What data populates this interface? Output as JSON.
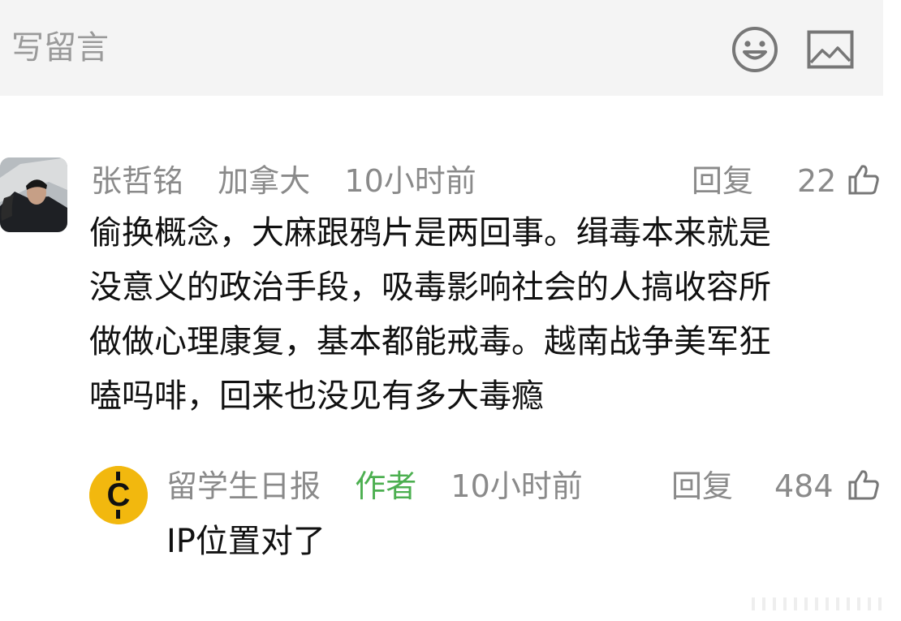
{
  "input_bar": {
    "placeholder": "写留言",
    "emoji_icon": "smiley-face-icon",
    "image_icon": "picture-icon"
  },
  "comment": {
    "username": "张哲铭",
    "location": "加拿大",
    "time": "10小时前",
    "reply_label": "回复",
    "likes": "22",
    "text_lines": [
      "偷换概念，大麻跟鸦片是两回事。缉毒本来就是",
      "没意义的政治手段，吸毒影响社会的人搞收容所",
      "做做心理康复，基本都能戒毒。越南战争美军狂",
      "嗑吗啡，回来也没见有多大毒瘾"
    ]
  },
  "reply": {
    "username": "留学生日报",
    "author_tag": "作者",
    "time": "10小时前",
    "reply_label": "回复",
    "likes": "484",
    "text": "IP位置对了",
    "avatar_letter": "C"
  },
  "colors": {
    "input_bg": "#f4f4f4",
    "meta_gray": "#8a8a8a",
    "author_green": "#4caf50",
    "badge_yellow": "#f2b80e"
  }
}
